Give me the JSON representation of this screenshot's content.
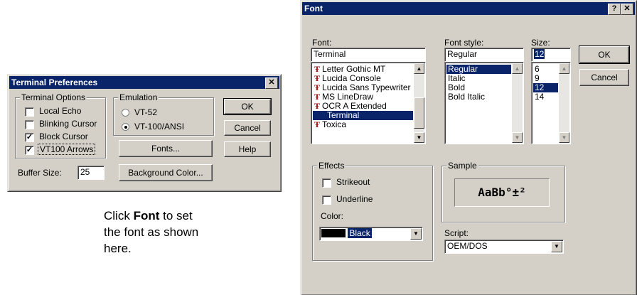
{
  "terminal_prefs": {
    "title": "Terminal Preferences",
    "close_glyph": "✕",
    "terminal_options_label": "Terminal Options",
    "options": [
      {
        "label": "Local Echo",
        "checked": false
      },
      {
        "label": "Blinking Cursor",
        "checked": false
      },
      {
        "label": "Block Cursor",
        "checked": true
      },
      {
        "label": "VT100 Arrows",
        "checked": true
      }
    ],
    "emulation_label": "Emulation",
    "emulation_options": [
      {
        "label": "VT-52",
        "selected": false
      },
      {
        "label": "VT-100/ANSI",
        "selected": true
      }
    ],
    "ok_label": "OK",
    "cancel_label": "Cancel",
    "help_label": "Help",
    "fonts_label": "Fonts...",
    "background_color_label": "Background Color...",
    "buffer_size_label": "Buffer Size:",
    "buffer_size_value": "25"
  },
  "caption": {
    "prefix": "Click",
    "bold": "Font",
    "rest_line1": "to set",
    "line2": "the font as shown",
    "line3": "here."
  },
  "font_dialog": {
    "title": "Font",
    "help_glyph": "?",
    "close_glyph": "✕",
    "font_label": "Font:",
    "font_value": "Terminal",
    "fonts": [
      {
        "name": "Letter Gothic MT",
        "selected": false
      },
      {
        "name": "Lucida Console",
        "selected": false
      },
      {
        "name": "Lucida Sans Typewriter",
        "selected": false
      },
      {
        "name": "MS LineDraw",
        "selected": false
      },
      {
        "name": "OCR A Extended",
        "selected": false
      },
      {
        "name": "Terminal",
        "selected": true
      },
      {
        "name": "Toxica",
        "selected": false
      }
    ],
    "style_label": "Font style:",
    "style_value": "Regular",
    "styles": [
      {
        "name": "Regular",
        "selected": true
      },
      {
        "name": "Italic",
        "selected": false
      },
      {
        "name": "Bold",
        "selected": false
      },
      {
        "name": "Bold Italic",
        "selected": false
      }
    ],
    "size_label": "Size:",
    "size_value": "12",
    "sizes": [
      {
        "name": "6",
        "selected": false
      },
      {
        "name": "9",
        "selected": false
      },
      {
        "name": "12",
        "selected": true
      },
      {
        "name": "14",
        "selected": false
      }
    ],
    "ok_label": "OK",
    "cancel_label": "Cancel",
    "effects_label": "Effects",
    "strikeout_label": "Strikeout",
    "underline_label": "Underline",
    "color_label": "Color:",
    "color_value": "Black",
    "color_swatch": "#000000",
    "sample_label": "Sample",
    "sample_text": "AaBb°±²",
    "script_label": "Script:",
    "script_value": "OEM/DOS"
  },
  "colors": {
    "face": "#d4d0c8",
    "titlebar": "#0a246a",
    "selection": "#0a246a"
  }
}
